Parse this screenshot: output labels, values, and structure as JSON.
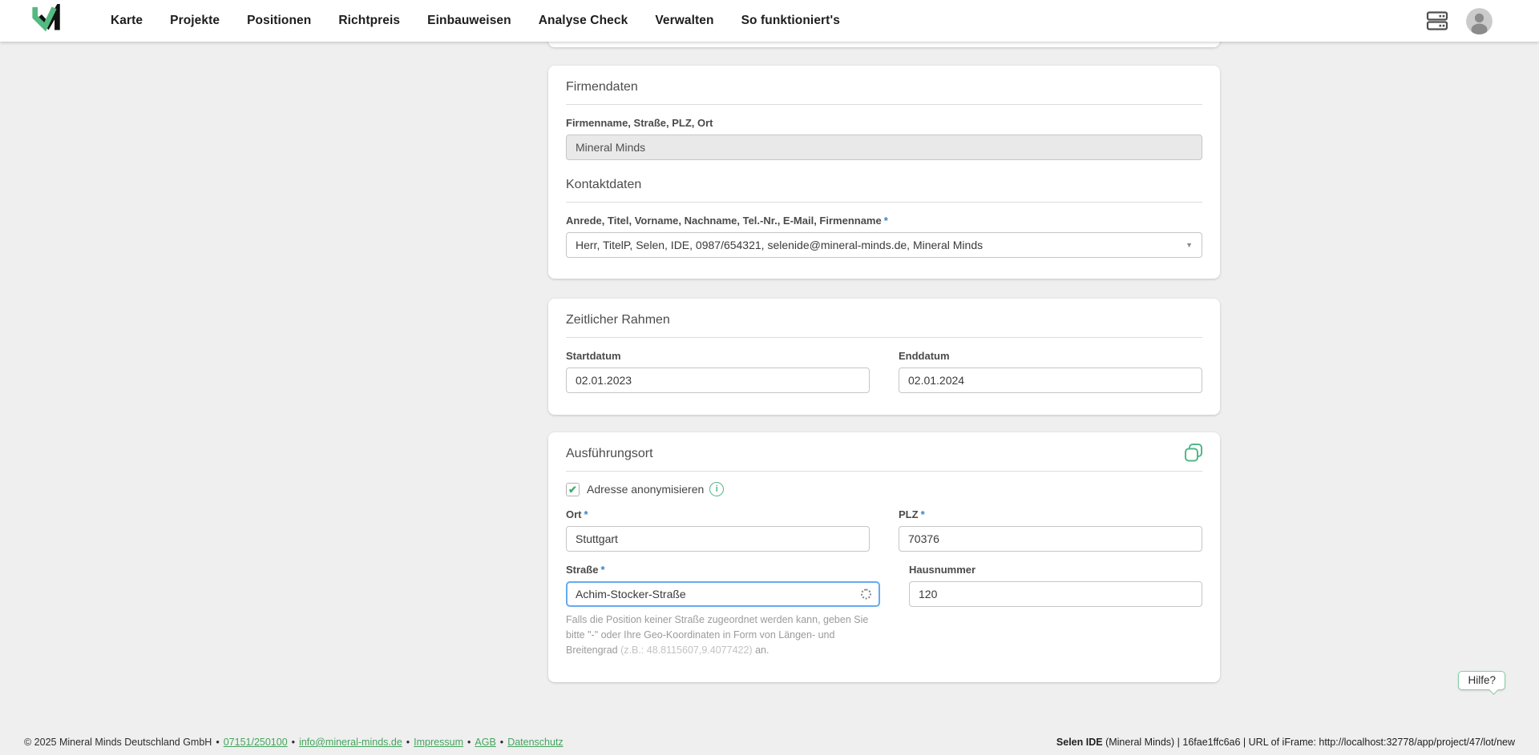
{
  "nav": {
    "items": [
      "Karte",
      "Projekte",
      "Positionen",
      "Richtpreis",
      "Einbauweisen",
      "Analyse Check",
      "Verwalten",
      "So funktioniert's"
    ]
  },
  "icons": {
    "check": "✔",
    "info": "i",
    "caret": "▼"
  },
  "marks": {
    "required": "*"
  },
  "firmendaten": {
    "title": "Firmendaten",
    "company_label": "Firmenname, Straße, PLZ, Ort",
    "company_value": "Mineral Minds",
    "kontakt_title": "Kontaktdaten",
    "kontakt_label": "Anrede, Titel, Vorname, Nachname, Tel.-Nr., E-Mail, Firmenname",
    "kontakt_value": "Herr, TitelP, Selen, IDE, 0987/654321, selenide@mineral-minds.de, Mineral Minds"
  },
  "zeitraum": {
    "title": "Zeitlicher Rahmen",
    "start_label": "Startdatum",
    "start_value": "02.01.2023",
    "end_label": "Enddatum",
    "end_value": "02.01.2024"
  },
  "ort": {
    "title": "Ausführungsort",
    "anonymize_label": "Adresse anonymisieren",
    "ort_label": "Ort",
    "ort_value": "Stuttgart",
    "plz_label": "PLZ",
    "plz_value": "70376",
    "strasse_label": "Straße",
    "strasse_value": "Achim-Stocker-Straße",
    "hausnummer_label": "Hausnummer",
    "hausnummer_value": "120",
    "hint_part1": "Falls die Position keiner Straße zugeordnet werden kann, geben Sie bitte \"-\" oder Ihre Geo-Koordinaten in Form von Längen- und Breitengrad ",
    "hint_example": "(z.B.: 48.8115607,9.4077422)",
    "hint_part3": " an."
  },
  "help": {
    "label": "Hilfe?"
  },
  "footer": {
    "copyright": "© 2025 Mineral Minds Deutschland GmbH",
    "separator": "•",
    "links": [
      "07151/250100",
      "info@mineral-minds.de",
      "Impressum",
      "AGB",
      "Datenschutz"
    ],
    "right_bold": "Selen IDE",
    "right_rest": " (Mineral Minds) | 16fae1ffc6a6 | URL of iFrame: http://localhost:32778/app/project/47/lot/new"
  },
  "colors": {
    "accent_green": "#52b788",
    "required_blue": "#3b82c4",
    "focus_blue": "#67aaf0"
  }
}
